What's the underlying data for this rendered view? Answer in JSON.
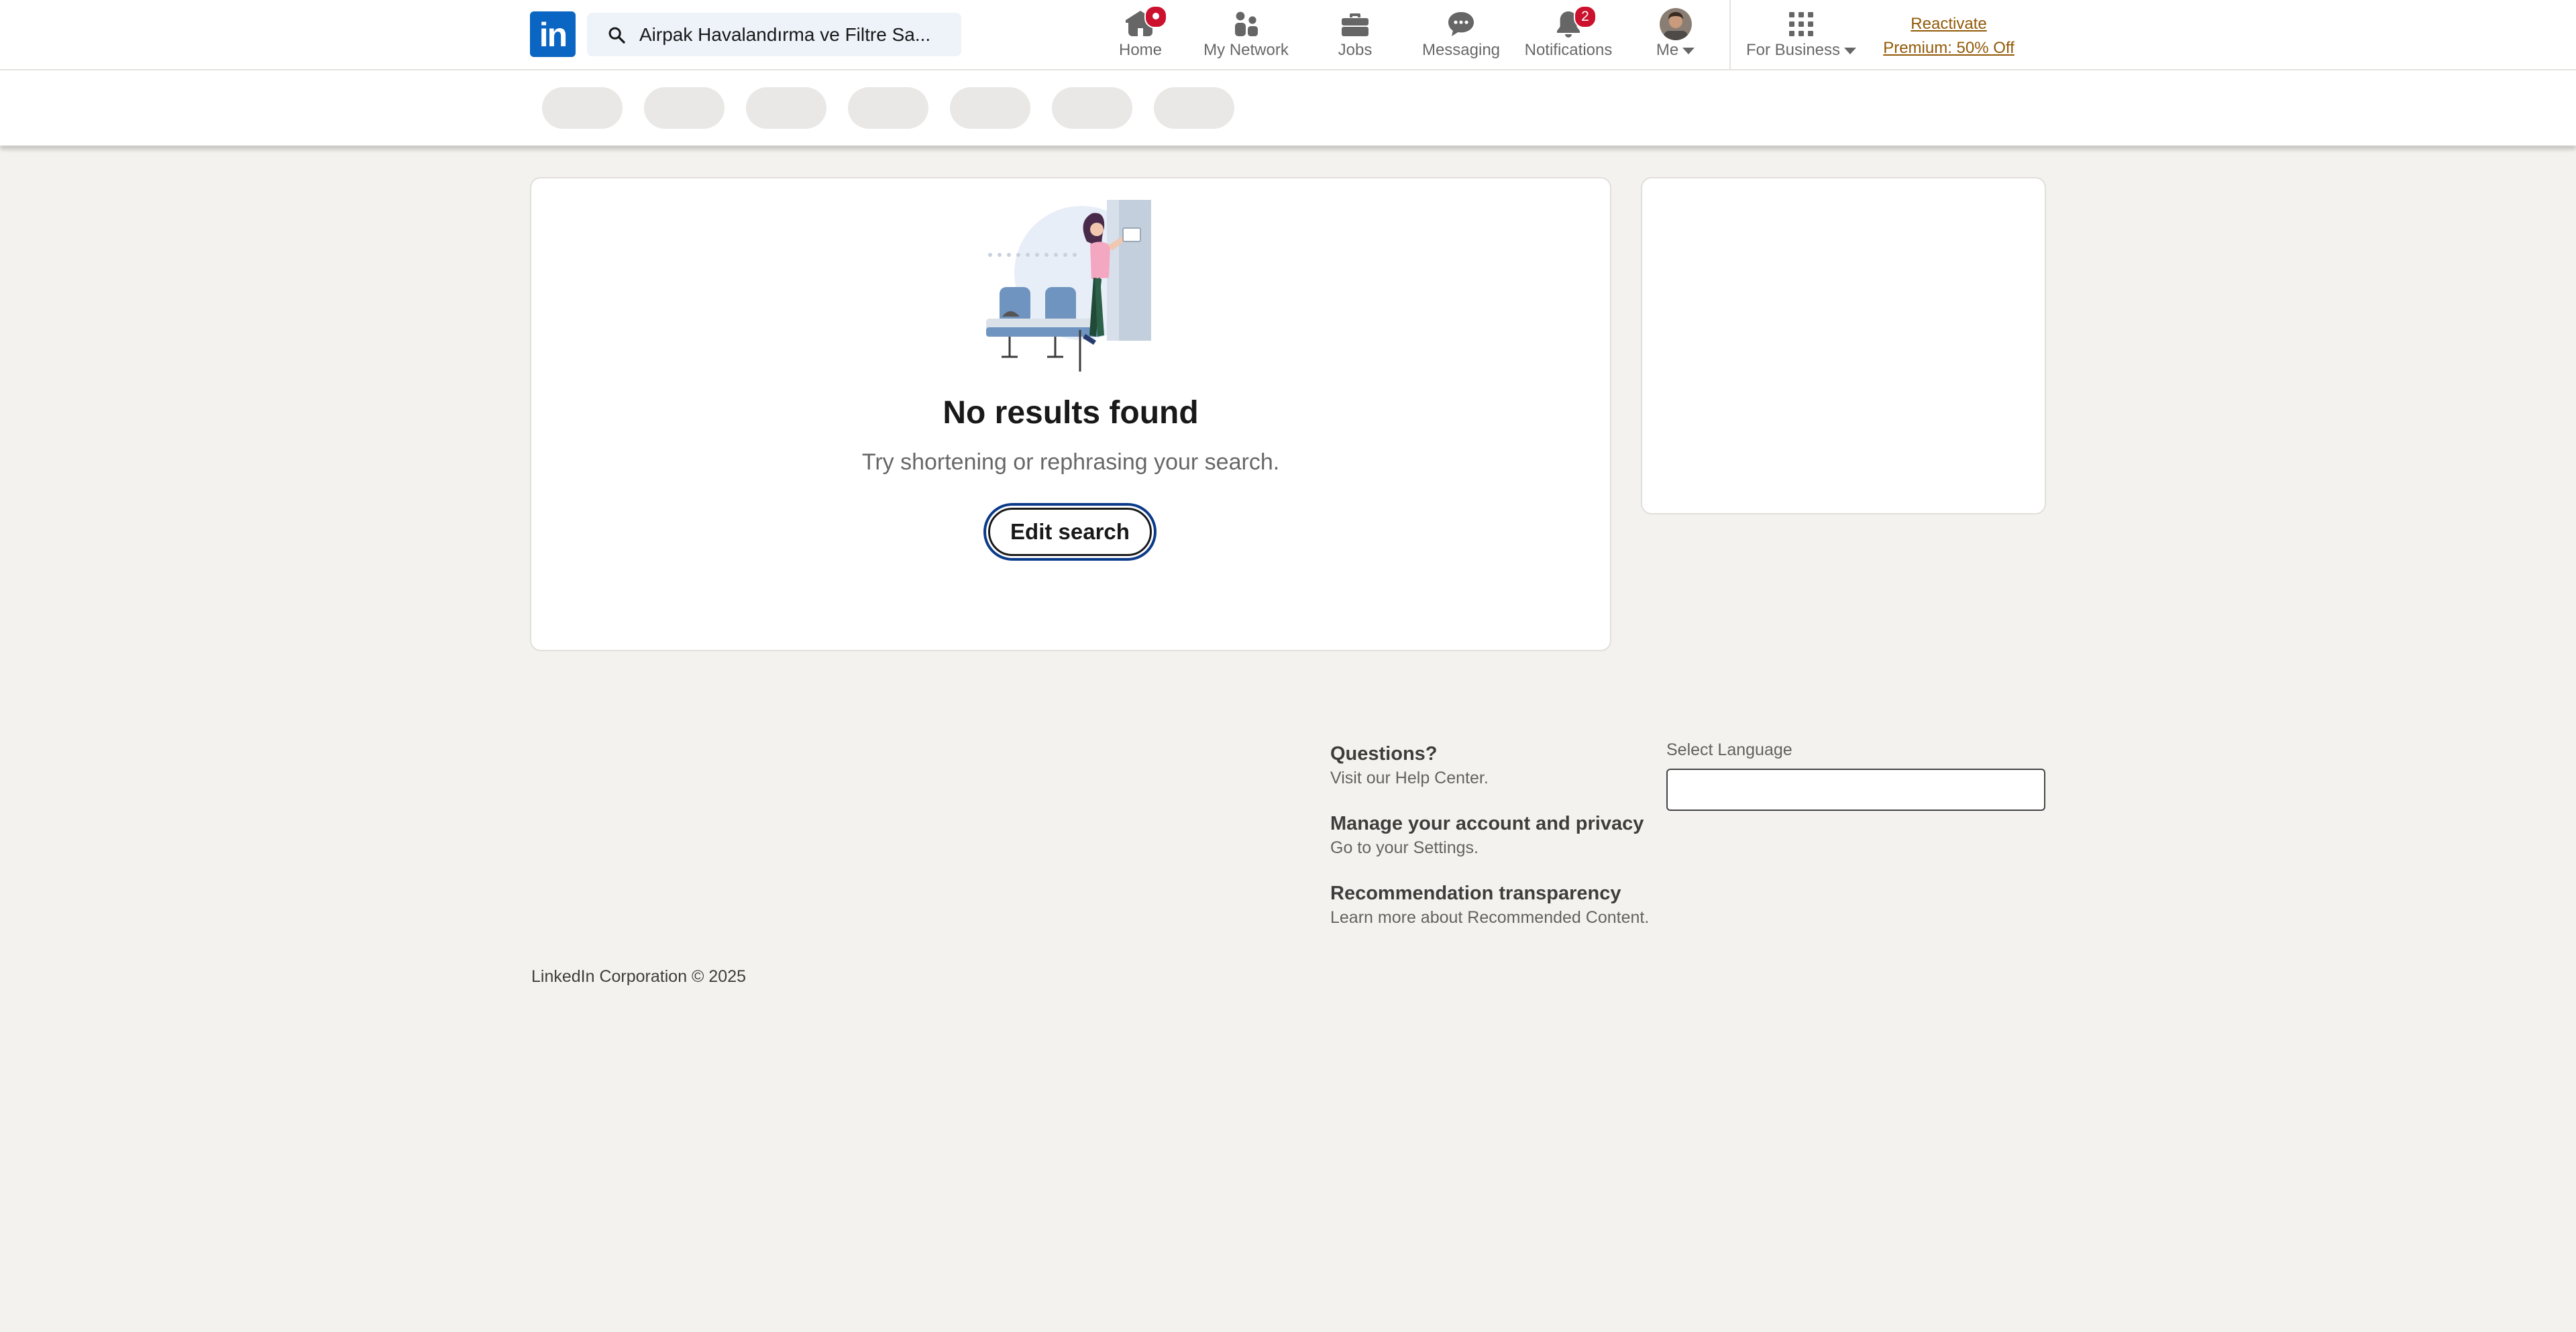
{
  "header": {
    "logo_text": "in",
    "search_value": "Airpak Havalandırma ve Filtre Sa...",
    "nav": [
      {
        "label": "Home",
        "icon": "home-icon",
        "badge": ""
      },
      {
        "label": "My Network",
        "icon": "people-icon",
        "badge": ""
      },
      {
        "label": "Jobs",
        "icon": "briefcase-icon",
        "badge": ""
      },
      {
        "label": "Messaging",
        "icon": "chat-icon",
        "badge": ""
      },
      {
        "label": "Notifications",
        "icon": "bell-icon",
        "badge": "2"
      },
      {
        "label": "Me",
        "icon": "avatar",
        "badge": ""
      },
      {
        "label": "For Business",
        "icon": "grid-icon",
        "badge": ""
      }
    ],
    "premium_line1": "Reactivate",
    "premium_line2": "Premium: 50% Off"
  },
  "main": {
    "title": "No results found",
    "subtitle": "Try shortening or rephrasing your search.",
    "edit_button": "Edit search"
  },
  "footer": {
    "links": [
      {
        "title": "Questions?",
        "desc": "Visit our Help Center."
      },
      {
        "title": "Manage your account and privacy",
        "desc": "Go to your Settings."
      },
      {
        "title": "Recommendation transparency",
        "desc": "Learn more about Recommended Content."
      }
    ],
    "language_label": "Select Language",
    "copyright": "LinkedIn Corporation © 2025"
  },
  "colors": {
    "brand": "#0a66c2",
    "badge": "#cb112d",
    "premium": "#915907",
    "page_bg": "#f4f2ee"
  }
}
